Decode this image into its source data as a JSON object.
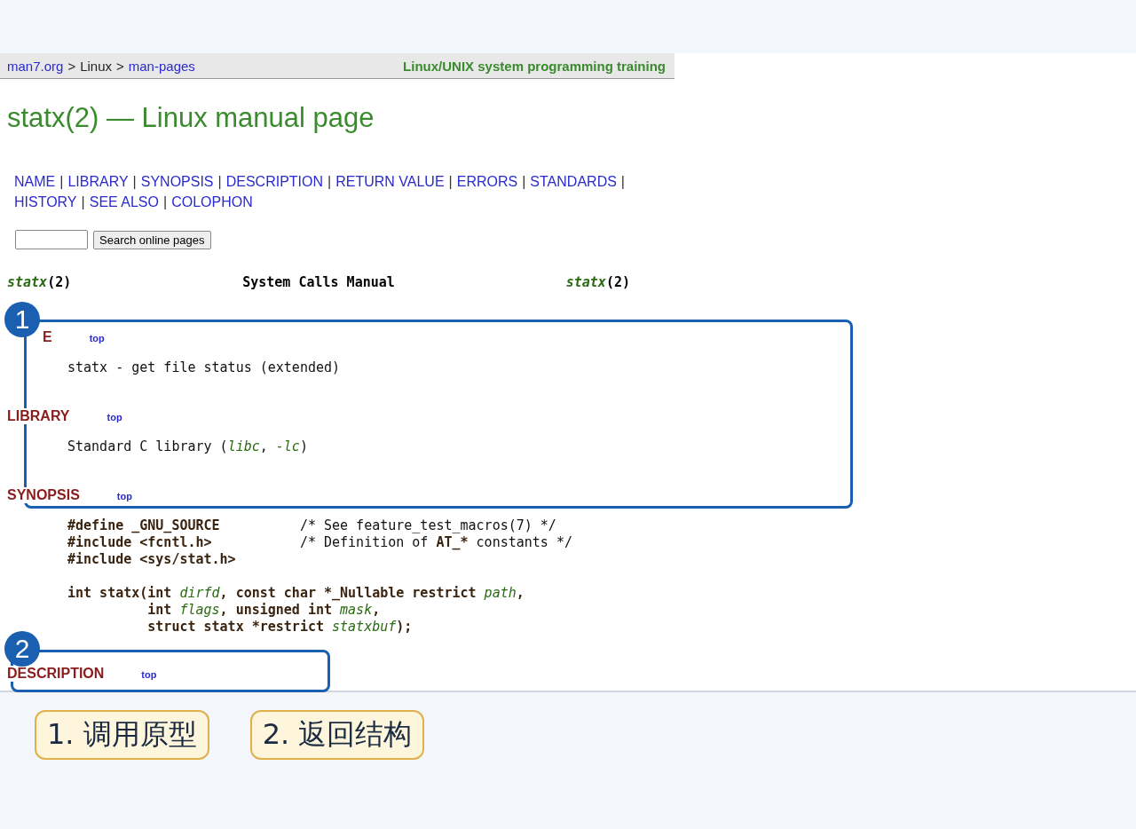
{
  "breadcrumb": [
    {
      "label": "man7.org",
      "kind": "link"
    },
    {
      "label": ">",
      "kind": "text"
    },
    {
      "label": "Linux",
      "kind": "text"
    },
    {
      "label": ">",
      "kind": "text"
    },
    {
      "label": "man-pages",
      "kind": "link"
    }
  ],
  "training_link": "Linux/UNIX system programming training",
  "title": "statx(2) — Linux manual page",
  "nav_rows": [
    [
      {
        "kind": "link",
        "label": "NAME"
      },
      {
        "kind": "separator",
        "label": "|"
      },
      {
        "kind": "link",
        "label": "LIBRARY"
      },
      {
        "kind": "separator",
        "label": "|"
      },
      {
        "kind": "link",
        "label": "SYNOPSIS"
      },
      {
        "kind": "separator",
        "label": "|"
      },
      {
        "kind": "link",
        "label": "DESCRIPTION"
      },
      {
        "kind": "separator",
        "label": "|"
      },
      {
        "kind": "link",
        "label": "RETURN VALUE"
      },
      {
        "kind": "separator",
        "label": "|"
      },
      {
        "kind": "link",
        "label": "ERRORS"
      },
      {
        "kind": "separator",
        "label": "|"
      },
      {
        "kind": "link",
        "label": "STANDARDS"
      },
      {
        "kind": "separator",
        "label": "|"
      }
    ],
    [
      {
        "kind": "link",
        "label": "HISTORY"
      },
      {
        "kind": "separator",
        "label": "|"
      },
      {
        "kind": "link",
        "label": "SEE ALSO"
      },
      {
        "kind": "separator",
        "label": "|"
      },
      {
        "kind": "link",
        "label": "COLOPHON"
      }
    ]
  ],
  "search": {
    "button": "Search online pages"
  },
  "man_header": {
    "left": "*statx*(2)",
    "center": "System Calls Manual",
    "right": "*statx*(2)"
  },
  "sections": [
    {
      "heading": "E",
      "top_link": "top",
      "kind": "text",
      "lines": [
        [
          {
            "kind": "plain",
            "text": "statx - get file status (extended)"
          }
        ]
      ]
    },
    {
      "heading": "LIBRARY",
      "top_link": "top",
      "kind": "text",
      "lines": [
        [
          {
            "kind": "plain",
            "text": "Standard C library ("
          },
          {
            "kind": "italic",
            "text": "libc"
          },
          {
            "kind": "plain",
            "text": ", "
          },
          {
            "kind": "italic",
            "text": "-lc"
          },
          {
            "kind": "plain",
            "text": ")"
          }
        ]
      ]
    },
    {
      "heading": "SYNOPSIS",
      "top_link": "top",
      "kind": "code",
      "lines": [
        [
          {
            "kind": "bold",
            "text": "#define _GNU_SOURCE"
          },
          {
            "kind": "plain",
            "text": "          /* See feature_test_macros(7) */"
          }
        ],
        [
          {
            "kind": "bold",
            "text": "#include <fcntl.h>"
          },
          {
            "kind": "plain",
            "text": "           /* Definition of "
          },
          {
            "kind": "bold",
            "text": "AT_*"
          },
          {
            "kind": "plain",
            "text": " constants */"
          }
        ],
        [
          {
            "kind": "bold",
            "text": "#include <sys/stat.h>"
          }
        ],
        [
          {
            "kind": "bold",
            "text": "int statx(int "
          },
          {
            "kind": "italic",
            "text": "dirfd"
          },
          {
            "kind": "bold",
            "text": ", const char *_Nullable restrict "
          },
          {
            "kind": "italic",
            "text": "path"
          },
          {
            "kind": "bold",
            "text": ","
          }
        ],
        [
          {
            "kind": "bold",
            "text": "          int "
          },
          {
            "kind": "italic",
            "text": "flags"
          },
          {
            "kind": "bold",
            "text": ", unsigned int "
          },
          {
            "kind": "italic",
            "text": "mask"
          },
          {
            "kind": "bold",
            "text": ","
          }
        ],
        [
          {
            "kind": "bold",
            "text": "          struct statx *restrict "
          },
          {
            "kind": "italic",
            "text": "statxbuf"
          },
          {
            "kind": "bold",
            "text": ");"
          }
        ]
      ]
    },
    {
      "heading": "DESCRIPTION",
      "top_link": "top",
      "kind": "none"
    }
  ],
  "markers": [
    "1",
    "2"
  ],
  "labels": [
    "1. 调用原型",
    "2. 返回结构"
  ]
}
